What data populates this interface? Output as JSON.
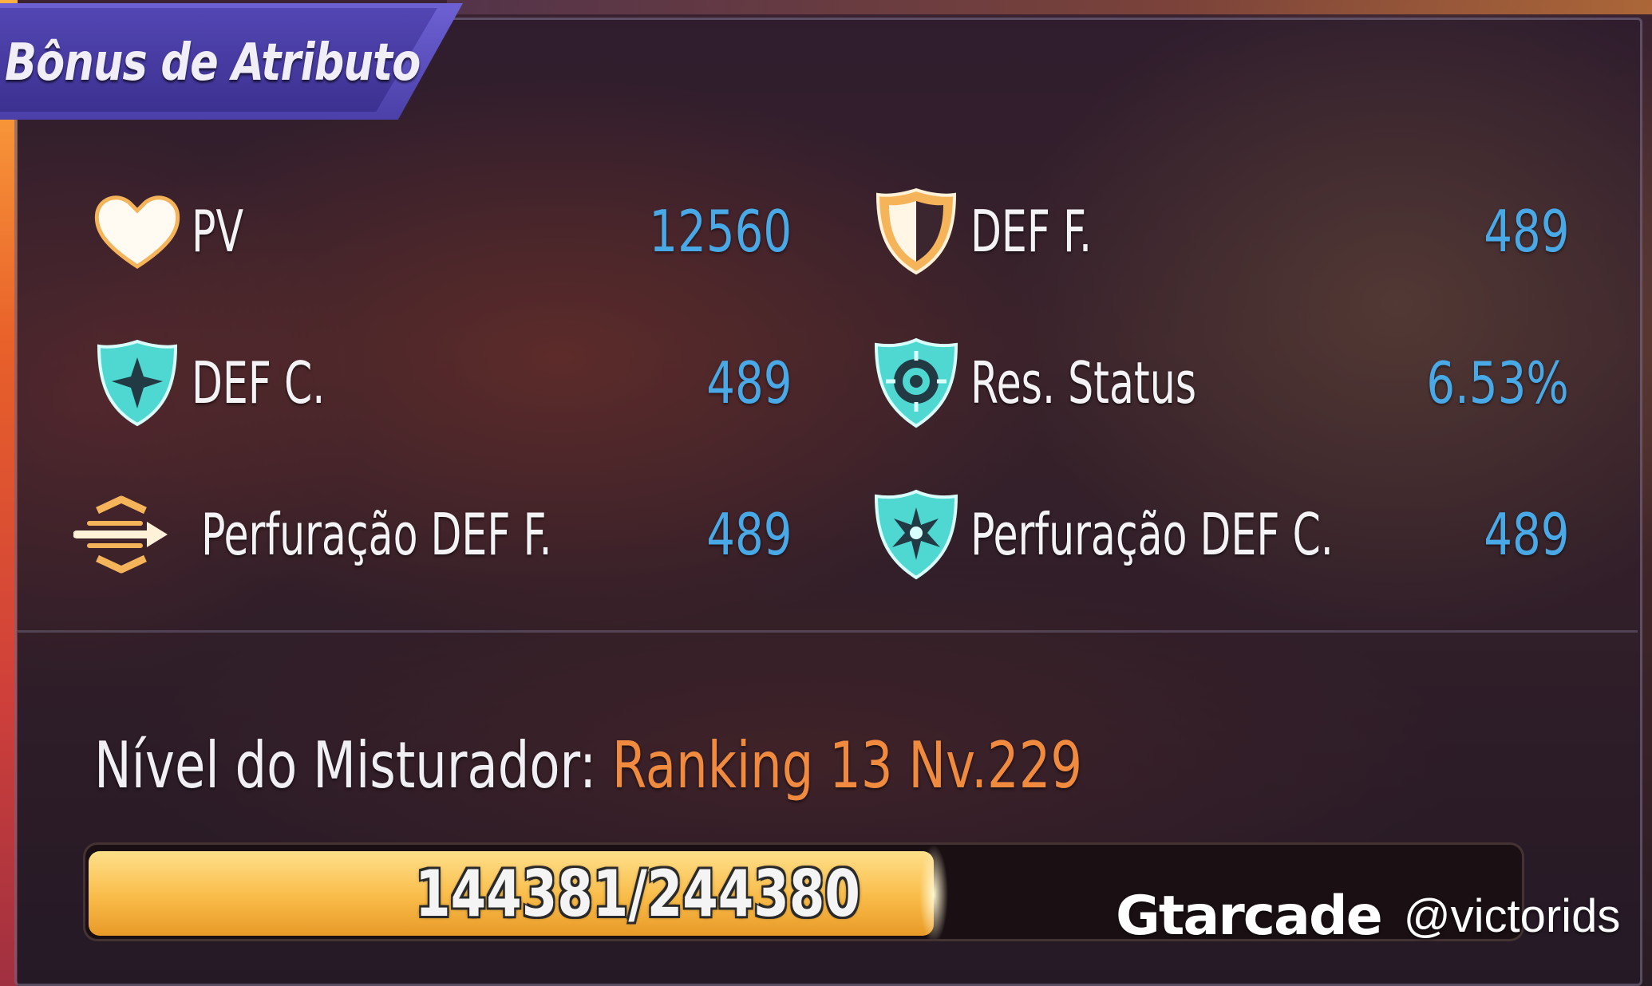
{
  "panel": {
    "title": "Bônus de Atributo"
  },
  "stats": {
    "left": [
      {
        "label": "PV",
        "value": "12560",
        "icon": "heart-icon"
      },
      {
        "label": "DEF C.",
        "value": "489",
        "icon": "star-shield-icon"
      },
      {
        "label": "Perfuração DEF F.",
        "value": "489",
        "icon": "piercing-arrow-icon"
      }
    ],
    "right": [
      {
        "label": "DEF F.",
        "value": "489",
        "icon": "shield-icon"
      },
      {
        "label": "Res. Status",
        "value": "6.53%",
        "icon": "target-shield-icon"
      },
      {
        "label": "Perfuração DEF C.",
        "value": "489",
        "icon": "burst-shield-icon"
      }
    ]
  },
  "mixer": {
    "label": "Nível do Misturador:",
    "value": "Ranking 13 Nv.229"
  },
  "progress": {
    "text": "144381/244380",
    "current": 144381,
    "max": 244380
  },
  "watermark": {
    "logo": "Gtarcade",
    "handle": "@victorids"
  },
  "colors": {
    "value_blue": "#49a8e6",
    "mixer_orange": "#f08a3e",
    "icon_orange": "#f6b45a",
    "icon_teal": "#4fd8d2",
    "tab_purple": "#5346b4",
    "bar_gold": "#f9bb48"
  }
}
